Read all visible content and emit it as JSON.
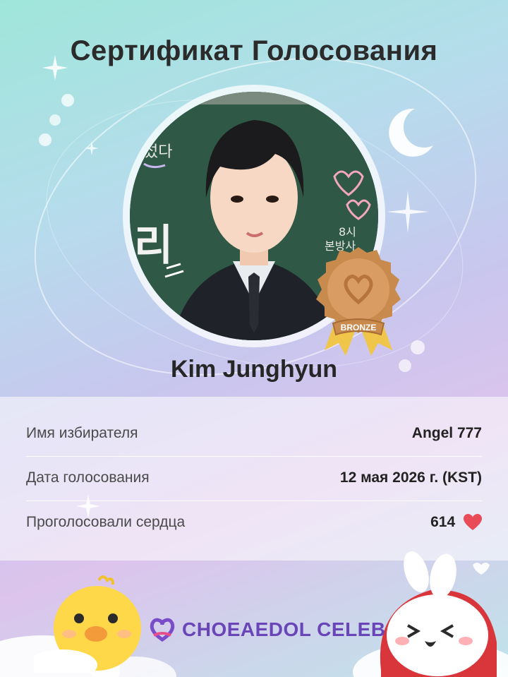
{
  "certificate": {
    "title": "Сертификат Голосования",
    "artist_name": "Kim Junghyun",
    "badge_label": "BRONZE",
    "background_text": [
      "섰다",
      "리",
      "8시",
      "본방사"
    ]
  },
  "details": {
    "voter_label": "Имя избирателя",
    "voter_value": "Angel 777",
    "date_label": "Дата голосования",
    "date_value": "12 мая 2026 г. (KST)",
    "hearts_label": "Проголосовали сердца",
    "hearts_value": "614"
  },
  "brand": {
    "logo_text": "CHOEAEDOL CELEB"
  },
  "icons": {
    "heart": "heart-icon",
    "moon": "crescent-moon-icon",
    "sparkle": "sparkle-icon",
    "logo": "brand-heart-logo-icon"
  },
  "colors": {
    "title": "#2b2b2b",
    "heart": "#e94b57",
    "badge": "#c98a4e",
    "logo": "#6a45b8"
  }
}
